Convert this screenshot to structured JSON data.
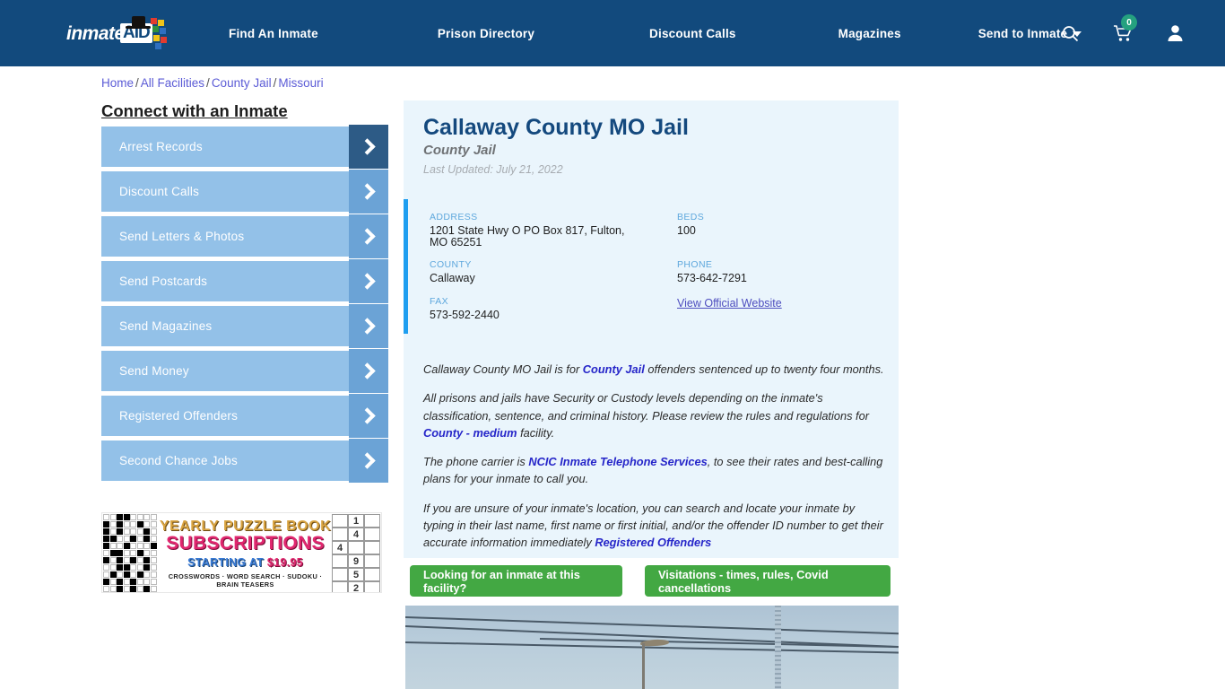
{
  "header": {
    "logo_text": "inmate",
    "logo_badge": "AID",
    "nav": [
      {
        "label": "Find An Inmate",
        "has_caret": false
      },
      {
        "label": "Prison Directory",
        "has_caret": false
      },
      {
        "label": "Discount Calls",
        "has_caret": false
      },
      {
        "label": "Magazines",
        "has_caret": false
      },
      {
        "label": "Send to Inmate",
        "has_caret": true
      }
    ],
    "search_icon": "search-icon",
    "cart_icon": "cart-icon",
    "cart_count": "0",
    "account_icon": "user-account-icon"
  },
  "breadcrumb": {
    "items": [
      "Home",
      "All Facilities",
      "County Jail",
      "Missouri"
    ],
    "separator": "/"
  },
  "sidebar": {
    "title": "Connect with an Inmate",
    "items": [
      {
        "label": "Arrest Records"
      },
      {
        "label": "Discount Calls"
      },
      {
        "label": "Send Letters & Photos"
      },
      {
        "label": "Send Postcards"
      },
      {
        "label": "Send Magazines"
      },
      {
        "label": "Send Money"
      },
      {
        "label": "Registered Offenders"
      },
      {
        "label": "Second Chance Jobs"
      }
    ]
  },
  "ad": {
    "line1": "YEARLY PUZZLE BOOK",
    "line2": "SUBSCRIPTIONS",
    "line3_prefix": "STARTING AT ",
    "line3_price": "$19.95",
    "line4": "CROSSWORDS · WORD SEARCH · SUDOKU · BRAIN TEASERS",
    "sudoku_digits": [
      "1",
      "4",
      "4",
      "9",
      "5",
      "2"
    ]
  },
  "facility": {
    "title": "Callaway County MO Jail",
    "subtitle": "County Jail",
    "last_updated": "Last Updated: July 21, 2022",
    "fields": {
      "address_label": "ADDRESS",
      "address_value": "1201 State Hwy O PO Box 817, Fulton, MO 65251",
      "county_label": "COUNTY",
      "county_value": "Callaway",
      "fax_label": "FAX",
      "fax_value": "573-592-2440",
      "beds_label": "BEDS",
      "beds_value": "100",
      "phone_label": "PHONE",
      "phone_value": "573-642-7291",
      "website_link": "View Official Website"
    },
    "paragraphs": {
      "p1_a": "Callaway County MO Jail is for ",
      "p1_link": "County Jail",
      "p1_b": " offenders sentenced up to twenty four months.",
      "p2_a": "All prisons and jails have Security or Custody levels depending on the inmate's classification, sentence, and criminal history. Please review the rules and regulations for ",
      "p2_link": "County - medium",
      "p2_b": " facility.",
      "p3_a": "The phone carrier is ",
      "p3_link": "NCIC Inmate Telephone Services",
      "p3_b": ", to see their rates and best-calling plans for your inmate to call you.",
      "p4_a": "If you are unsure of your inmate's location, you can search and locate your inmate by typing in their last name, first name or first initial, and/or the offender ID number to get their accurate information immediately ",
      "p4_link": "Registered Offenders"
    }
  },
  "actions": {
    "inmate_search_label": "Looking for an inmate at this facility?",
    "visitation_label": "Visitations - times, rules, Covid cancellations"
  },
  "colors": {
    "header_blue": "#124a7d",
    "card_bg": "#eaf5fc",
    "accent_bar": "#1e9ef0",
    "sidebar_blue": "#93c1e8",
    "sidebar_arrow": "#6ba3d6",
    "sidebar_arrow_active": "#2d5b86",
    "green_button": "#43a843",
    "cart_badge_green": "#25a17f",
    "link_purple": "#5b5bd6",
    "title_navy": "#14497e"
  }
}
